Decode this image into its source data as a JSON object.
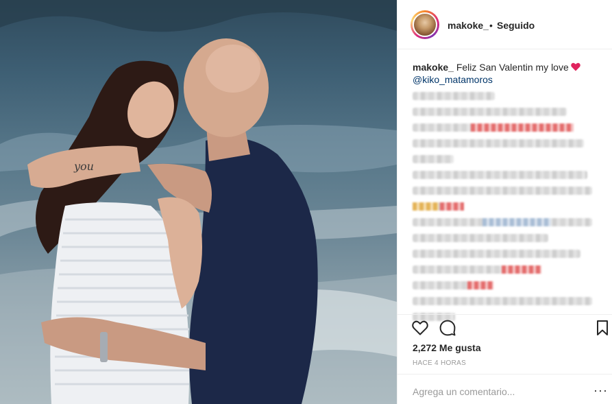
{
  "post": {
    "username": "makoke_",
    "separator": "•",
    "follow_status": "Seguido",
    "caption_text": " Feliz San Valentin my love",
    "mention": "@kiko_matamoros",
    "likes": "2,272 Me gusta",
    "timestamp": "HACE 4 HORAS",
    "comment_placeholder": "Agrega un comentario...",
    "more_label": "···"
  },
  "icons": {
    "like": "heart-outline-icon",
    "comment": "speech-bubble-icon",
    "save": "bookmark-icon",
    "caption_emoji": "red-heart-icon"
  },
  "colors": {
    "link": "#003569",
    "heart": "#e0245e",
    "meta_text": "#999999"
  }
}
